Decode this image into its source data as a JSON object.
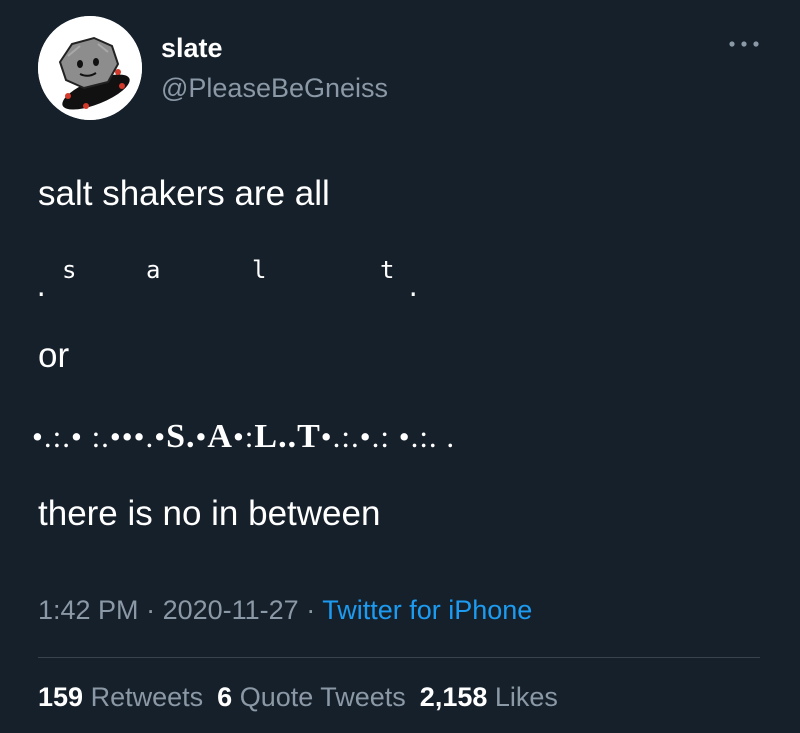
{
  "author": {
    "display_name": "slate",
    "handle": "@PleaseBeGneiss",
    "avatar_icon": "gray-rock-with-face-icon"
  },
  "menu_icon": "more-options-icon",
  "tweet": {
    "line1": "salt shakers are all",
    "spaced_word": {
      "dot_left": ".",
      "s": "s",
      "a": "a",
      "l": "l",
      "t": "t",
      "dot_right": "."
    },
    "line_or": "or",
    "dotted_word": {
      "prefix": "•.:.• :.•••.•",
      "s": "S.",
      "sep1": "•",
      "a": "A",
      "sep2": "•:",
      "l": "L..",
      "t": "T",
      "suffix": "•.:.•.: •.:. ."
    },
    "line_last": "there is no in between"
  },
  "meta": {
    "time": "1:42 PM",
    "separator": "·",
    "date": "2020-11-27",
    "source": "Twitter for iPhone"
  },
  "stats": {
    "retweets_count": "159",
    "retweets_label": "Retweets",
    "quotes_count": "6",
    "quotes_label": "Quote Tweets",
    "likes_count": "2,158",
    "likes_label": "Likes"
  },
  "colors": {
    "background": "#15202b",
    "text_primary": "#ffffff",
    "text_secondary": "#8b98a5",
    "link": "#1d9bf0",
    "divider": "#38444d"
  }
}
